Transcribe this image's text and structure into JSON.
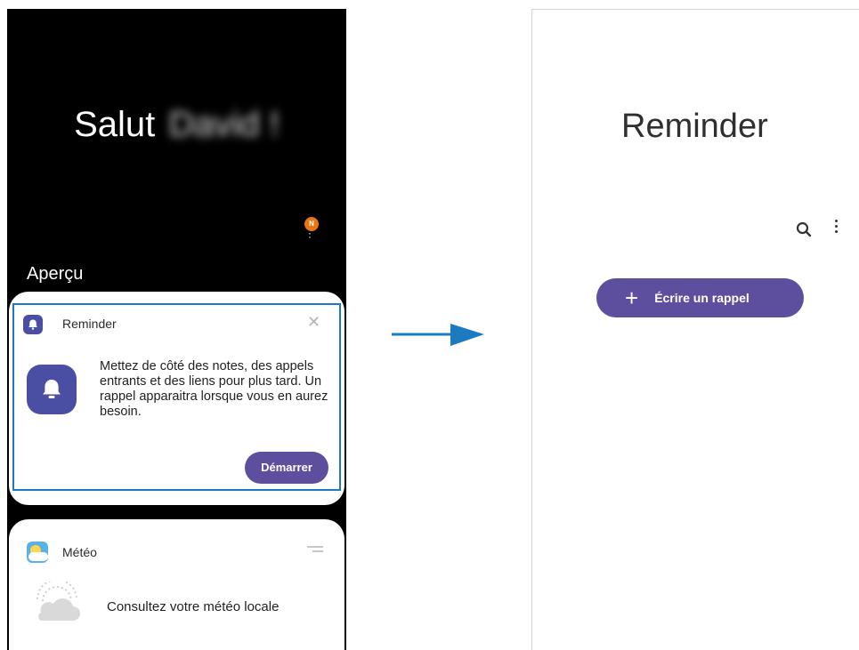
{
  "left_screen": {
    "greeting": "Salut",
    "user_name": "David !",
    "notification_badge": "N",
    "section_title": "Aperçu",
    "reminder_card": {
      "title": "Reminder",
      "close_icon": "✕",
      "body": "Mettez de côté des notes, des appels entrants et des liens pour plus tard. Un rappel apparaitra lorsque vous en aurez besoin.",
      "start_button": "Démarrer"
    },
    "meteo_card": {
      "title": "Météo",
      "body": "Consultez votre météo locale"
    }
  },
  "right_screen": {
    "app_title": "Reminder",
    "write_button": "Écrire un rappel",
    "plus_icon": "+"
  },
  "colors": {
    "accent": "#5d4e9e",
    "icon_bg": "#4b4fa4",
    "highlight": "#1c7bc0",
    "arrow": "#1c7bc0",
    "badge": "#e8750f"
  }
}
